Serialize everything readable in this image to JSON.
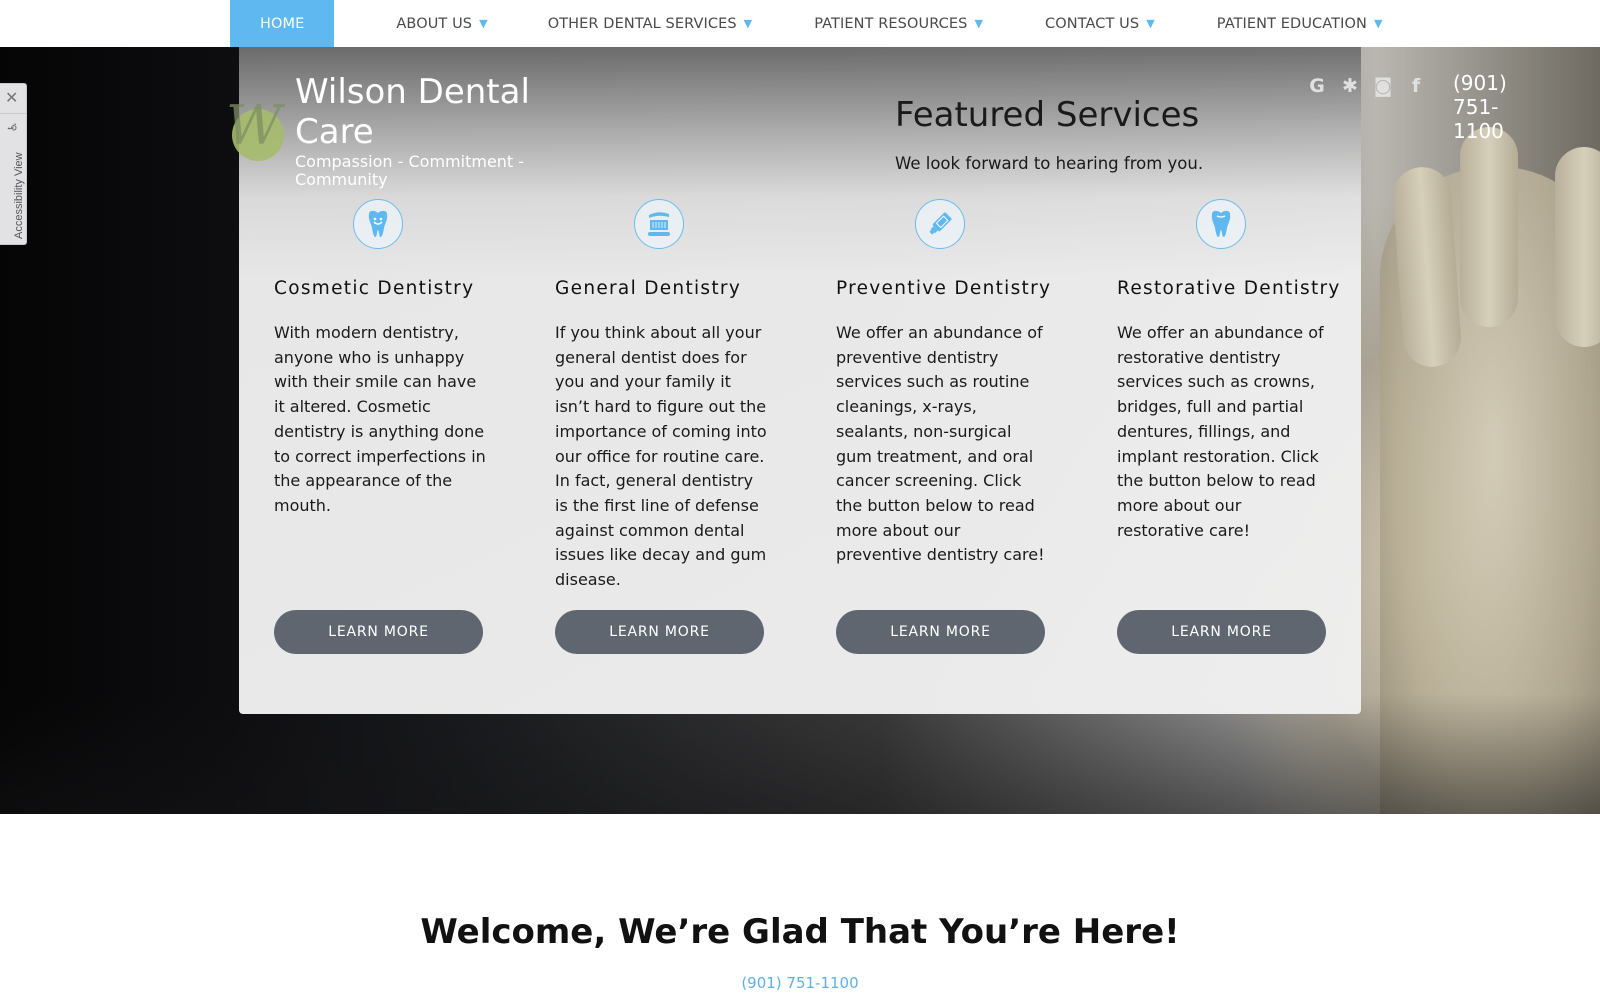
{
  "nav": {
    "items": [
      {
        "label": "HOME",
        "active": true,
        "has_dropdown": false
      },
      {
        "label": "ABOUT US",
        "has_dropdown": true
      },
      {
        "label": "OTHER DENTAL SERVICES",
        "has_dropdown": true
      },
      {
        "label": "PATIENT RESOURCES",
        "has_dropdown": true
      },
      {
        "label": "CONTACT US",
        "has_dropdown": true
      },
      {
        "label": "PATIENT EDUCATION",
        "has_dropdown": true
      }
    ],
    "caret": "▼"
  },
  "accessibility": {
    "close_glyph": "✕",
    "label": "Accessibility View",
    "icon": "wheelchair-icon"
  },
  "brand": {
    "logo_letter": "W",
    "title": "Wilson Dental Care",
    "tagline": "Compassion - Commitment - Community"
  },
  "social": [
    {
      "name": "google-icon",
      "glyph": "G"
    },
    {
      "name": "yelp-icon",
      "glyph": "✱"
    },
    {
      "name": "instagram-icon",
      "glyph": "◙"
    },
    {
      "name": "facebook-icon",
      "glyph": "f"
    }
  ],
  "header_phone": "(901) 751-1100",
  "featured": {
    "title": "Featured Services",
    "subtitle": "We look forward to hearing from you."
  },
  "services": [
    {
      "icon": "smiling-tooth-icon",
      "title": "Cosmetic Dentistry",
      "text": "With modern dentistry, anyone who is unhappy with their smile can have it altered. Cosmetic dentistry is anything done to correct imperfections in the appearance of the mouth.",
      "button": "LEARN MORE"
    },
    {
      "icon": "toothbrush-icon",
      "title": "General Dentistry",
      "text": "If you think about all your general dentist does for you and your family it isn’t hard to figure out the importance of coming into our office for routine care. In fact, general dentistry is the first line of defense against common dental issues like decay and gum disease.",
      "button": "LEARN MORE"
    },
    {
      "icon": "toothpaste-icon",
      "title": "Preventive Dentistry",
      "text": "We offer an abundance of preventive dentistry services such as routine cleanings, x-rays, sealants, non-surgical gum treatment, and oral cancer screening. Click the button below to read more about our preventive dentistry care!",
      "button": "LEARN MORE"
    },
    {
      "icon": "tooth-icon",
      "title": "Restorative Dentistry",
      "text": "We offer an abundance of restorative dentistry services such as crowns, bridges, full and partial dentures, fillings, and implant restoration. Click the button below to read more about our restorative care!",
      "button": "LEARN MORE"
    }
  ],
  "welcome": {
    "title": "Welcome, We’re Glad That You’re Here!",
    "phone": "(901) 751-1100"
  },
  "colors": {
    "accent": "#5fb8f0",
    "button": "#5f6670",
    "logo_green": "#a6bb6b"
  }
}
